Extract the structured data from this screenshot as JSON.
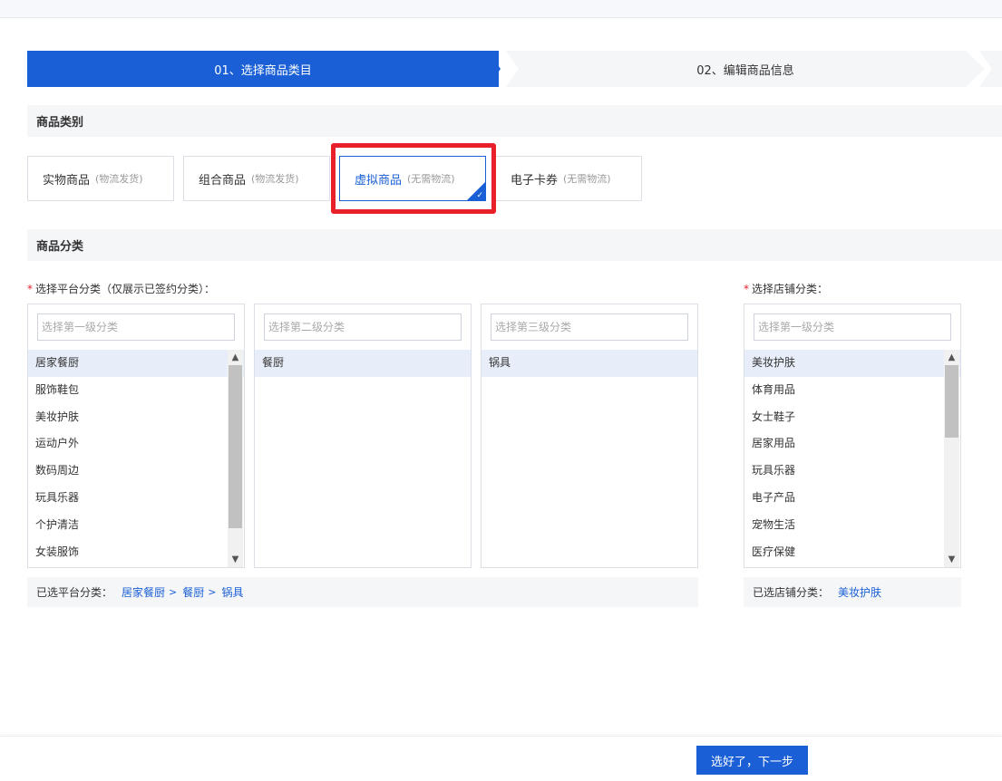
{
  "steps": [
    {
      "label": "01、选择商品类目",
      "active": true
    },
    {
      "label": "02、编辑商品信息",
      "active": false
    }
  ],
  "section_type": {
    "title": "商品类别"
  },
  "types": [
    {
      "name": "实物商品",
      "sub": "(物流发货)"
    },
    {
      "name": "组合商品",
      "sub": "(物流发货)"
    },
    {
      "name": "虚拟商品",
      "sub": "(无需物流)"
    },
    {
      "name": "电子卡券",
      "sub": "(无需物流)"
    }
  ],
  "section_category": {
    "title": "商品分类"
  },
  "platform": {
    "label": "选择平台分类（仅展示已签约分类）：",
    "level1": {
      "placeholder": "选择第一级分类",
      "items": [
        "居家餐厨",
        "服饰鞋包",
        "美妆护肤",
        "运动户外",
        "数码周边",
        "玩具乐器",
        "个护清洁",
        "女装服饰"
      ]
    },
    "level2": {
      "placeholder": "选择第二级分类",
      "items": [
        "餐厨"
      ]
    },
    "level3": {
      "placeholder": "选择第三级分类",
      "items": [
        "锅具"
      ]
    },
    "selected_label": "已选平台分类：",
    "selected_path": [
      "居家餐厨",
      "餐厨",
      "锅具"
    ],
    "path_sep": ">"
  },
  "shop": {
    "label": "选择店铺分类：",
    "level1": {
      "placeholder": "选择第一级分类",
      "items": [
        "美妆护肤",
        "体育用品",
        "女士鞋子",
        "居家用品",
        "玩具乐器",
        "电子产品",
        "宠物生活",
        "医疗保健"
      ]
    },
    "selected_label": "已选店铺分类：",
    "selected_value": "美妆护肤"
  },
  "required_mark": "*",
  "footer": {
    "next_label": "选好了，下一步"
  },
  "colors": {
    "primary": "#1a5fd6",
    "highlight": "#e8202a"
  }
}
